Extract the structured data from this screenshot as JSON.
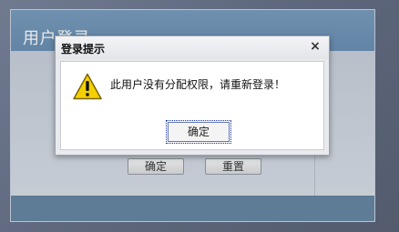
{
  "login_panel": {
    "title": "用户登录",
    "confirm_label": "确定",
    "reset_label": "重置"
  },
  "dialog": {
    "title": "登录提示",
    "close_glyph": "×",
    "message": "此用户没有分配权限，请重新登录！",
    "ok_label": "确定",
    "icon": "warning-icon"
  },
  "colors": {
    "header_blue": "#5d86ad",
    "footer_blue": "#587c99",
    "warning_yellow": "#f5d000"
  }
}
